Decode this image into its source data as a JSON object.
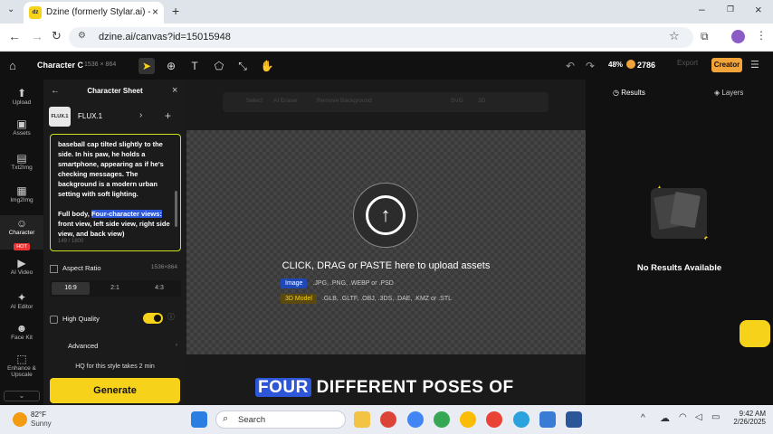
{
  "browser": {
    "tab_title": "Dzine (formerly Stylar.ai) - The",
    "tab_favicon": "dz",
    "url": "dzine.ai/canvas?id=15015948"
  },
  "app": {
    "project_name": "Character C",
    "canvas_dims": "1536 × 864",
    "zoom": "48%",
    "credits": "2786",
    "export_label": "Export",
    "creator_label": "Creator"
  },
  "left_nav": [
    {
      "label": "Upload",
      "icon": "upload-icon"
    },
    {
      "label": "Assets",
      "icon": "assets-icon"
    },
    {
      "label": "Txt2Img",
      "icon": "txt2img-icon"
    },
    {
      "label": "Img2Img",
      "icon": "img2img-icon"
    },
    {
      "label": "Character",
      "icon": "character-icon",
      "badge": "HOT"
    },
    {
      "label": "AI Video",
      "icon": "video-icon"
    },
    {
      "label": "AI Editor",
      "icon": "editor-icon"
    },
    {
      "label": "Face Kit",
      "icon": "face-icon"
    },
    {
      "label": "Enhance &",
      "label2": "Upscale",
      "icon": "enhance-icon"
    }
  ],
  "panel": {
    "title": "Character Sheet",
    "model_thumb": "FLUX.1",
    "model_name": "FLUX.1",
    "prompt_text_1": "baseball cap tilted slightly to the side. In his paw, he holds a smartphone, appearing as if he's checking messages. The background is a modern urban setting with soft lighting.",
    "prompt_text_2a": "Full body, ",
    "prompt_highlight": "Four-character views:",
    "prompt_text_2b": " front view, left side view, right side view, and back view)",
    "prompt_count": "149 / 1800",
    "aspect_label": "Aspect Ratio",
    "aspect_value": "1536×864",
    "ratios": [
      "16:9",
      "2:1",
      "4:3"
    ],
    "high_quality_label": "High Quality",
    "advanced_label": "Advanced",
    "hq_note": "HQ for this style takes 2 min",
    "generate_label": "Generate"
  },
  "canvas": {
    "toolstrip": [
      "Select",
      "AI Eraser",
      "Remove Background",
      "SVG",
      "3D"
    ],
    "drop_text": "CLICK, DRAG or PASTE here to upload assets",
    "image_badge": "Image",
    "image_formats": ".JPG, .PNG, .WEBP or .PSD",
    "model_badge": "3D Model",
    "model_formats": ".GLB, .GLTF, .OBJ, .3DS, .DAE, .KMZ or .STL"
  },
  "results": {
    "tab_results": "Results",
    "tab_layers": "Layers",
    "empty_label": "No Results Available"
  },
  "caption": {
    "highlight": "FOUR",
    "rest": " DIFFERENT POSES OF"
  },
  "taskbar": {
    "temp": "82°F",
    "weather": "Sunny",
    "search": "Search",
    "time": "9:42 AM",
    "date": "2/26/2025"
  },
  "colors": {
    "accent_yellow": "#f7d21b",
    "highlight_blue": "#2d57d8",
    "creator_orange": "#f2a33a"
  }
}
